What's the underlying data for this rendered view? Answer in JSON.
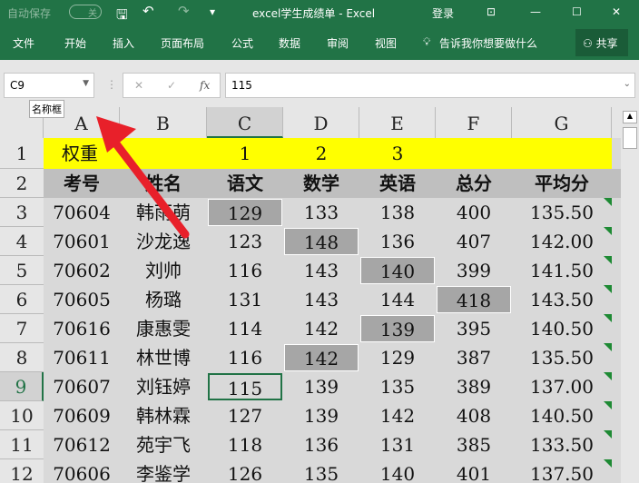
{
  "titlebar": {
    "autosave": "自动保存",
    "toggle": "关",
    "title": "excel学生成绩单  -  Excel",
    "login": "登录"
  },
  "ribbon": {
    "tabs": [
      "文件",
      "开始",
      "插入",
      "页面布局",
      "公式",
      "数据",
      "审阅",
      "视图"
    ],
    "tell_me": "告诉我你想要做什么",
    "share": "共享"
  },
  "formula_bar": {
    "name_box": "C9",
    "fx": "fx",
    "value": "115",
    "tooltip": "名称框"
  },
  "columns": [
    "A",
    "B",
    "C",
    "D",
    "E",
    "F",
    "G"
  ],
  "row_numbers": [
    "1",
    "2",
    "3",
    "4",
    "5",
    "6",
    "7",
    "8",
    "9",
    "10",
    "11",
    "12"
  ],
  "row1": {
    "label": "权重",
    "c": "1",
    "d": "2",
    "e": "3"
  },
  "headers": [
    "考号",
    "姓名",
    "语文",
    "数学",
    "英语",
    "总分",
    "平均分"
  ],
  "rows": [
    [
      "70604",
      "韩雨萌",
      "129",
      "133",
      "138",
      "400",
      "135.50"
    ],
    [
      "70601",
      "沙龙逸",
      "123",
      "148",
      "136",
      "407",
      "142.00"
    ],
    [
      "70602",
      "刘帅",
      "116",
      "143",
      "140",
      "399",
      "141.50"
    ],
    [
      "70605",
      "杨璐",
      "131",
      "143",
      "144",
      "418",
      "143.50"
    ],
    [
      "70616",
      "康惠雯",
      "114",
      "142",
      "139",
      "395",
      "140.50"
    ],
    [
      "70611",
      "林世博",
      "116",
      "142",
      "129",
      "387",
      "135.50"
    ],
    [
      "70607",
      "刘钰婷",
      "115",
      "139",
      "135",
      "389",
      "137.00"
    ],
    [
      "70609",
      "韩林霖",
      "127",
      "139",
      "142",
      "408",
      "140.50"
    ],
    [
      "70612",
      "苑宇飞",
      "118",
      "136",
      "131",
      "385",
      "133.50"
    ],
    [
      "70606",
      "李鉴学",
      "126",
      "135",
      "140",
      "401",
      "137.50"
    ]
  ],
  "highlighted": [
    [
      0,
      2
    ],
    [
      1,
      3
    ],
    [
      2,
      4
    ],
    [
      3,
      5
    ],
    [
      4,
      4
    ],
    [
      5,
      3
    ]
  ],
  "selected_cell": [
    6,
    2
  ],
  "colors": {
    "accent": "#217346",
    "row1_fill": "#ffff00",
    "highlight": "#a6a6a6",
    "arrow": "#e8202a"
  }
}
